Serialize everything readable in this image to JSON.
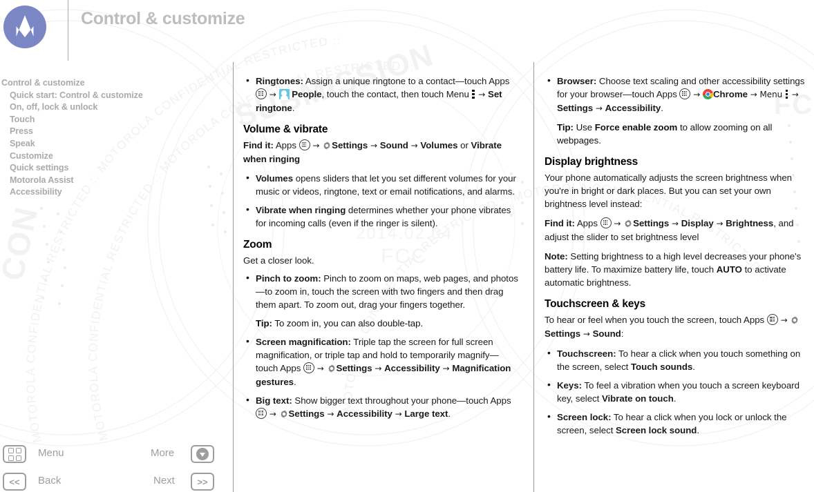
{
  "header": {
    "title": "Control & customize",
    "logo_alt": "motorola-logo"
  },
  "sidebar": {
    "items": [
      {
        "label": "Control & customize",
        "level": 0
      },
      {
        "label": "Quick start: Control & customize",
        "level": 1
      },
      {
        "label": "On, off, lock & unlock",
        "level": 1
      },
      {
        "label": "Touch",
        "level": 1
      },
      {
        "label": "Press",
        "level": 1
      },
      {
        "label": "Speak",
        "level": 1
      },
      {
        "label": "Customize",
        "level": 1
      },
      {
        "label": "Quick settings",
        "level": 1
      },
      {
        "label": "Motorola Assist",
        "level": 1
      },
      {
        "label": "Accessibility",
        "level": 1
      }
    ]
  },
  "bottom_nav": {
    "menu_label": "Menu",
    "more_label": "More",
    "back_label": "Back",
    "next_label": "Next",
    "back_glyph": "<<",
    "next_glyph": ">>"
  },
  "middle_column": {
    "ringtones": {
      "term": "Ringtones:",
      "t1": " Assign a unique ringtone to a contact—touch Apps ",
      "t2": " → ",
      "t3": " ",
      "people": "People",
      "t4": ", touch the contact, then touch Menu ",
      "t5": " → ",
      "set_ringtone": "Set ringtone",
      "t6": "."
    },
    "volume_heading": "Volume & vibrate",
    "volume_findit": {
      "find_it": "Find it:",
      "t1": " Apps ",
      "t2": " → ",
      "settings": "Settings",
      "a1": " → ",
      "sound": "Sound",
      "a2": " → ",
      "volumes": "Volumes",
      "or": " or ",
      "vibrate_when_ringing": "Vibrate when ringing"
    },
    "volumes_bullet": {
      "term": "Volumes",
      "text": " opens sliders that let you set different volumes for your music or videos, ringtone, text or email notifications, and alarms."
    },
    "vibrate_bullet": {
      "term": "Vibrate when ringing",
      "text": " determines whether your phone vibrates for incoming calls (even if the ringer is silent)."
    },
    "zoom_heading": "Zoom",
    "zoom_intro": "Get a closer look.",
    "pinch_bullet": {
      "term": "Pinch to zoom:",
      "text": " Pinch to zoom on maps, web pages, and photos—to zoom in, touch the screen with two fingers and then drag them apart. To zoom out, drag your fingers together."
    },
    "pinch_tip": {
      "label": "Tip:",
      "text": " To zoom in, you can also double-tap."
    },
    "magnification_bullet": {
      "term": "Screen magnification:",
      "t1": " Triple tap the screen for full screen magnification, or triple tap and hold to temporarily magnify—touch Apps ",
      "t2": " → ",
      "settings": "Settings",
      "a1": " → ",
      "accessibility": "Accessibility",
      "a2": " → ",
      "magnification_gestures": "Magnification gestures",
      "end": "."
    },
    "bigtext_bullet": {
      "term": "Big text:",
      "t1": " Show bigger text throughout your phone—touch Apps ",
      "t2": " → ",
      "settings": "Settings",
      "a1": " → ",
      "accessibility": "Accessibility",
      "a2": " → ",
      "large_text": "Large text",
      "end": "."
    }
  },
  "right_column": {
    "browser_bullet": {
      "term": "Browser:",
      "t1": " Choose text scaling and other accessibility settings for your browser—touch Apps ",
      "t2": " → ",
      "chrome": "Chrome",
      "a1": " → Menu ",
      "a2": " → ",
      "settings": "Settings",
      "a3": " → ",
      "accessibility": "Accessibility",
      "end": "."
    },
    "browser_tip": {
      "label": "Tip:",
      "t1": " Use ",
      "force_enable_zoom": "Force enable zoom",
      "t2": " to allow zooming on all webpages."
    },
    "brightness_heading": "Display brightness",
    "brightness_intro": "Your phone automatically adjusts the screen brightness when you're in bright or dark places. But you can set your own brightness level instead:",
    "brightness_findit": {
      "find_it": "Find it:",
      "t1": " Apps ",
      "t2": " → ",
      "settings": "Settings",
      "a1": " → ",
      "display": "Display",
      "a2": " → ",
      "brightness": "Brightness",
      "tail": ", and adjust the slider to set brightness level"
    },
    "brightness_note": {
      "label": "Note:",
      "t1": " Setting brightness to a high level decreases your phone's battery life. To maximize battery life, touch ",
      "auto": "AUTO",
      "t2": " to activate automatic brightness."
    },
    "touchscreen_heading": "Touchscreen & keys",
    "touchscreen_intro": {
      "t1": "To hear or feel when you touch the screen, touch Apps ",
      "a1": " → ",
      "settings": "Settings",
      "a2": " → ",
      "sound": "Sound",
      "end": ":"
    },
    "touchscreen_bullet": {
      "term": "Touchscreen:",
      "t1": " To hear a click when you touch something on the screen, select ",
      "touch_sounds": "Touch sounds",
      "end": "."
    },
    "keys_bullet": {
      "term": "Keys:",
      "t1": " To feel a vibration when you touch a screen keyboard key, select ",
      "vibrate_on_touch": "Vibrate on touch",
      "end": "."
    },
    "screenlock_bullet": {
      "term": "Screen lock:",
      "t1": " To hear a click when you lock or unlock the screen, select ",
      "screen_lock_sound": "Screen lock sound",
      "end": "."
    }
  },
  "watermarks": {
    "ring_text": "MOTOROLA CONFIDENTIAL RESTRICTED :: MOTOROLA CONFIDENTIAL RESTRICTED :: ",
    "fcc": "FCC",
    "date": "2014.02.04",
    "corner_left": "CON",
    "corner_right": "FCC"
  },
  "colors": {
    "logo_blue": "#7b86c4",
    "title_gray": "#bdbdbd",
    "nav_gray": "#aaaaaa",
    "chrome_red": "#ea4335",
    "chrome_yellow": "#fbbc05",
    "chrome_green": "#34a853",
    "chrome_blue": "#4285f4",
    "people_blue": "#64c8e0"
  }
}
